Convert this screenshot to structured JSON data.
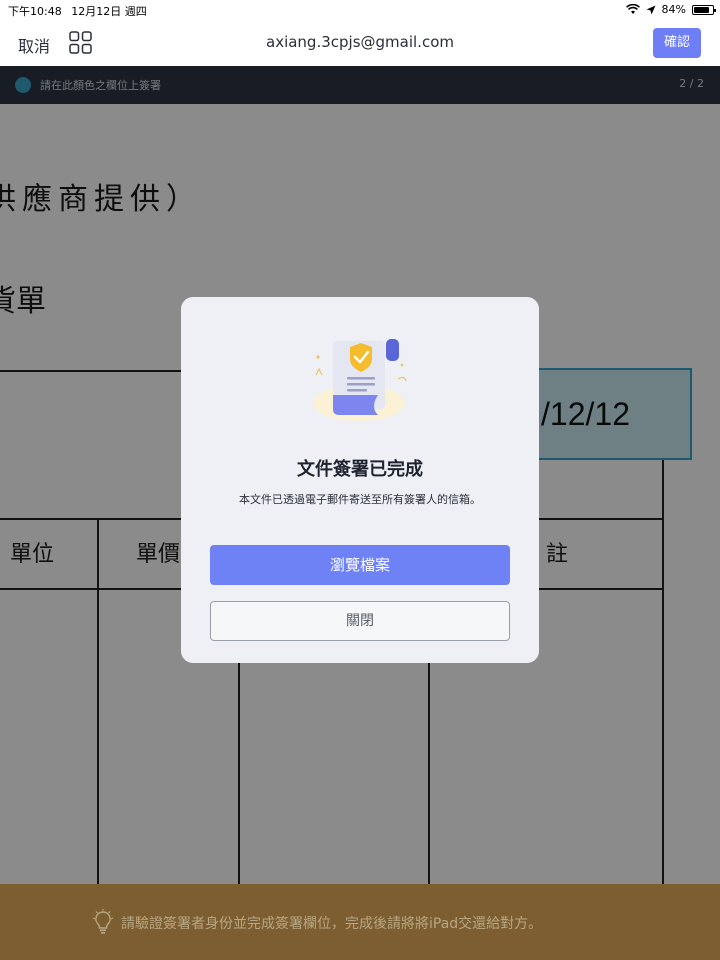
{
  "status_bar": {
    "time": "下午10:48",
    "date": "12月12日 週四",
    "battery_text": "84%",
    "battery_level": 0.84
  },
  "header": {
    "cancel_label": "取消",
    "email": "axiang.3cpjs@gmail.com",
    "confirm_label": "確認"
  },
  "instruction_bar": {
    "text": "請在此顏色之欄位上簽署",
    "page_indicator": "2 / 2",
    "field_color": "#3aa3c7"
  },
  "document": {
    "line1": "供應商提供）",
    "line2": "貨單",
    "date_field_value": "/12/12",
    "table_headers": [
      "單位",
      "單價",
      "註"
    ]
  },
  "modal": {
    "title": "文件簽署已完成",
    "message": "本文件已透過電子郵件寄送至所有簽署人的信箱。",
    "primary_button": "瀏覽檔案",
    "secondary_button": "關閉",
    "illustration_icon": "signed-document-shield-icon",
    "accent_color": "#6e82f5"
  },
  "bottom_banner": {
    "text": "請驗證簽署者身份並完成簽署欄位，完成後請將將iPad交還給對方。",
    "icon": "lightbulb-icon"
  }
}
